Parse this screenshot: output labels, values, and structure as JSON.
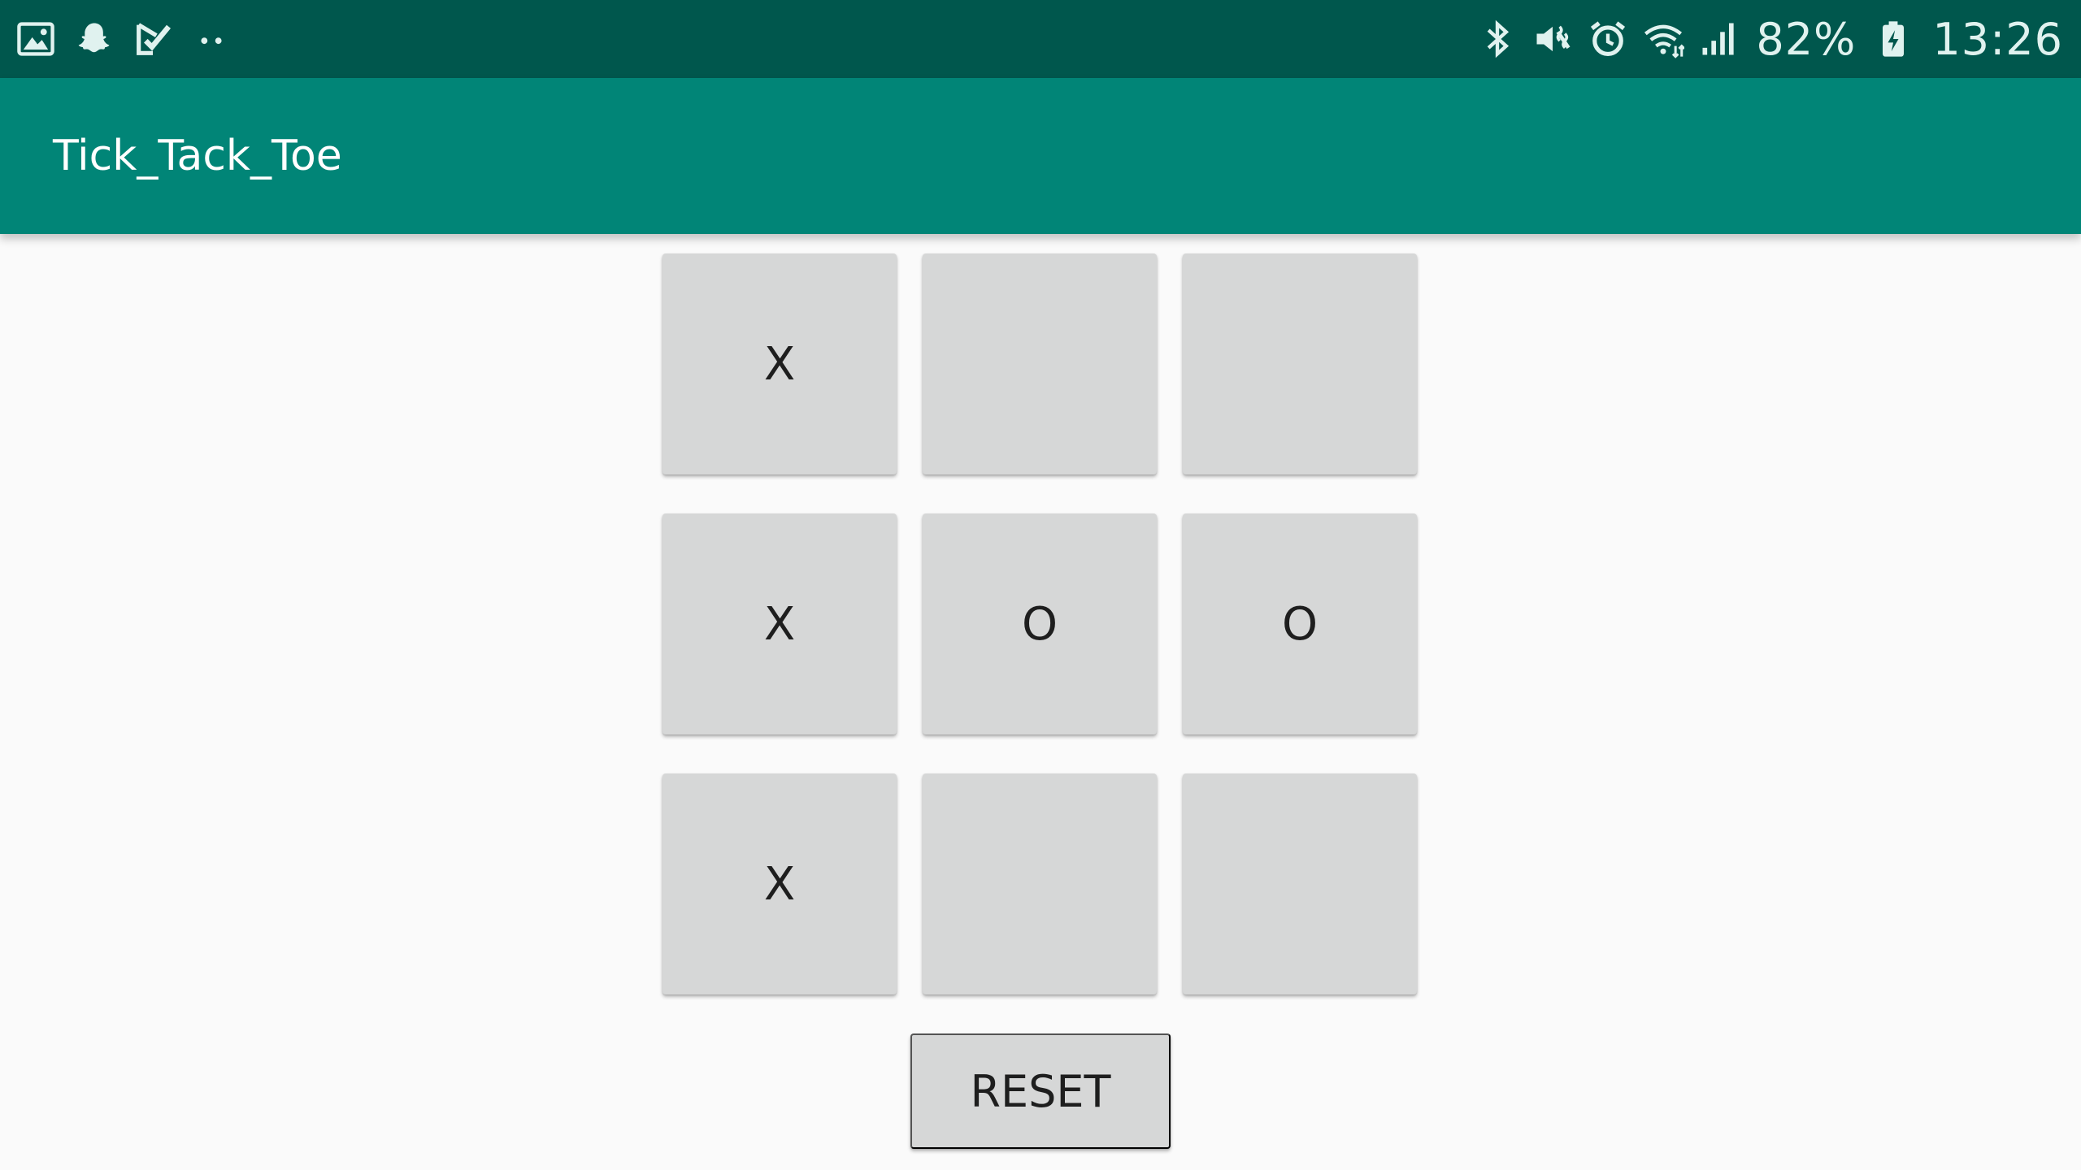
{
  "status_bar": {
    "left_icons": [
      "gallery-icon",
      "snapchat-icon",
      "task-check-icon",
      "more-dots-icon"
    ],
    "right_icons": [
      "bluetooth-icon",
      "vibrate-mute-icon",
      "alarm-icon",
      "wifi-icon",
      "signal-icon",
      "battery-charging-icon"
    ],
    "battery_percent": "82%",
    "time": "13:26"
  },
  "app_bar": {
    "title": "Tick_Tack_Toe"
  },
  "board": {
    "cells": [
      [
        "X",
        "",
        ""
      ],
      [
        "X",
        "O",
        "O"
      ],
      [
        "X",
        "",
        ""
      ]
    ]
  },
  "reset_button": {
    "label": "RESET"
  },
  "colors": {
    "status_bar": "#00574D",
    "app_bar": "#018577",
    "background": "#FAFAFA",
    "button": "#D6D7D7",
    "button_text": "#1E1E1E"
  }
}
